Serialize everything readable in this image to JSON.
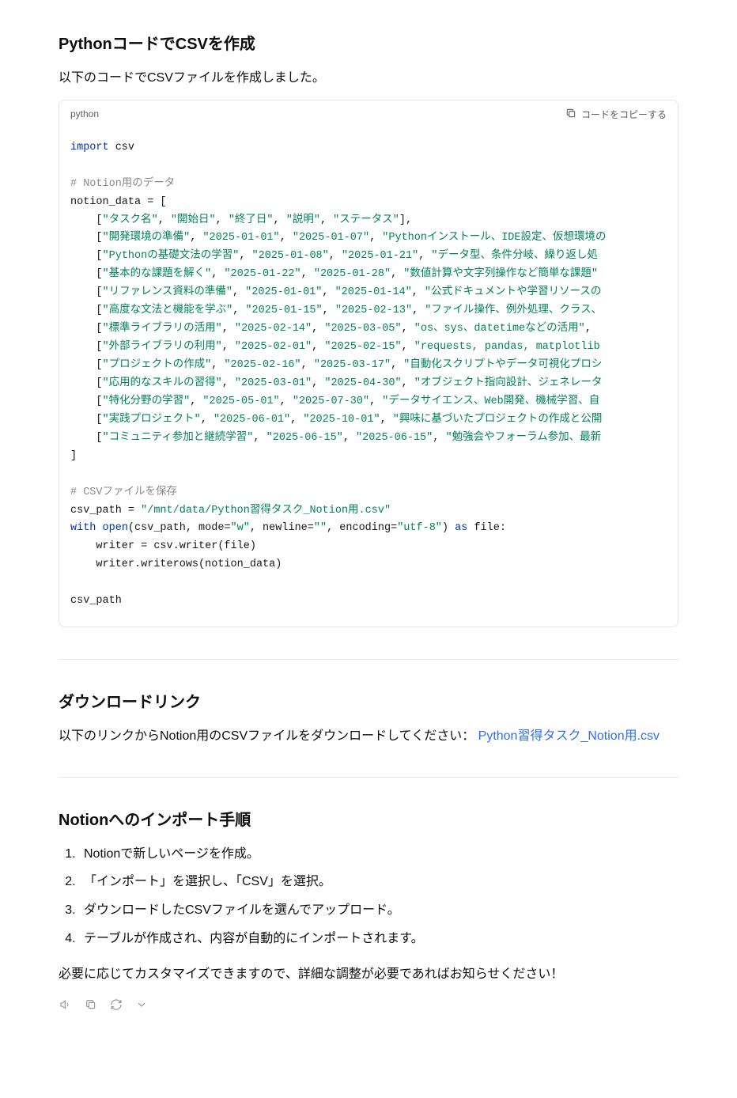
{
  "section1": {
    "heading": "PythonコードでCSVを作成",
    "intro": "以下のコードでCSVファイルを作成しました。"
  },
  "code": {
    "language": "python",
    "copy_label": "コードをコピーする",
    "comment1": "# Notion用のデータ",
    "comment2": "# CSVファイルを保存",
    "csv_path_string": "\"/mnt/data/Python習得タスク_Notion用.csv\"",
    "header_row": [
      "\"タスク名\"",
      "\"開始日\"",
      "\"終了日\"",
      "\"説明\"",
      "\"ステータス\""
    ],
    "rows": [
      [
        "\"開発環境の準備\"",
        "\"2025-01-01\"",
        "\"2025-01-07\"",
        "\"Pythonインストール、IDE設定、仮想環境の"
      ],
      [
        "\"Pythonの基礎文法の学習\"",
        "\"2025-01-08\"",
        "\"2025-01-21\"",
        "\"データ型、条件分岐、繰り返し処"
      ],
      [
        "\"基本的な課題を解く\"",
        "\"2025-01-22\"",
        "\"2025-01-28\"",
        "\"数値計算や文字列操作など簡単な課題\""
      ],
      [
        "\"リファレンス資料の準備\"",
        "\"2025-01-01\"",
        "\"2025-01-14\"",
        "\"公式ドキュメントや学習リソースの"
      ],
      [
        "\"高度な文法と機能を学ぶ\"",
        "\"2025-01-15\"",
        "\"2025-02-13\"",
        "\"ファイル操作、例外処理、クラス、"
      ],
      [
        "\"標準ライブラリの活用\"",
        "\"2025-02-14\"",
        "\"2025-03-05\"",
        "\"os、sys、datetimeなどの活用\"",
        ""
      ],
      [
        "\"外部ライブラリの利用\"",
        "\"2025-02-01\"",
        "\"2025-02-15\"",
        "\"requests, pandas, matplotlib"
      ],
      [
        "\"プロジェクトの作成\"",
        "\"2025-02-16\"",
        "\"2025-03-17\"",
        "\"自動化スクリプトやデータ可視化プロシ"
      ],
      [
        "\"応用的なスキルの習得\"",
        "\"2025-03-01\"",
        "\"2025-04-30\"",
        "\"オブジェクト指向設計、ジェネレータ"
      ],
      [
        "\"特化分野の学習\"",
        "\"2025-05-01\"",
        "\"2025-07-30\"",
        "\"データサイエンス、Web開発、機械学習、自"
      ],
      [
        "\"実践プロジェクト\"",
        "\"2025-06-01\"",
        "\"2025-10-01\"",
        "\"興味に基づいたプロジェクトの作成と公開"
      ],
      [
        "\"コミュニティ参加と継続学習\"",
        "\"2025-06-15\"",
        "\"2025-06-15\"",
        "\"勉強会やフォーラム参加、最新"
      ]
    ]
  },
  "section2": {
    "heading": "ダウンロードリンク",
    "text_before": "以下のリンクからNotion用のCSVファイルをダウンロードしてください： ",
    "link_text": "Python習得タスク_Notion用.csv"
  },
  "section3": {
    "heading": "Notionへのインポート手順",
    "steps": [
      "Notionで新しいページを作成。",
      "「インポート」を選択し、「CSV」を選択。",
      "ダウンロードしたCSVファイルを選んでアップロード。",
      "テーブルが作成され、内容が自動的にインポートされます。"
    ],
    "closing": "必要に応じてカスタマイズできますので、詳細な調整が必要であればお知らせください！"
  }
}
